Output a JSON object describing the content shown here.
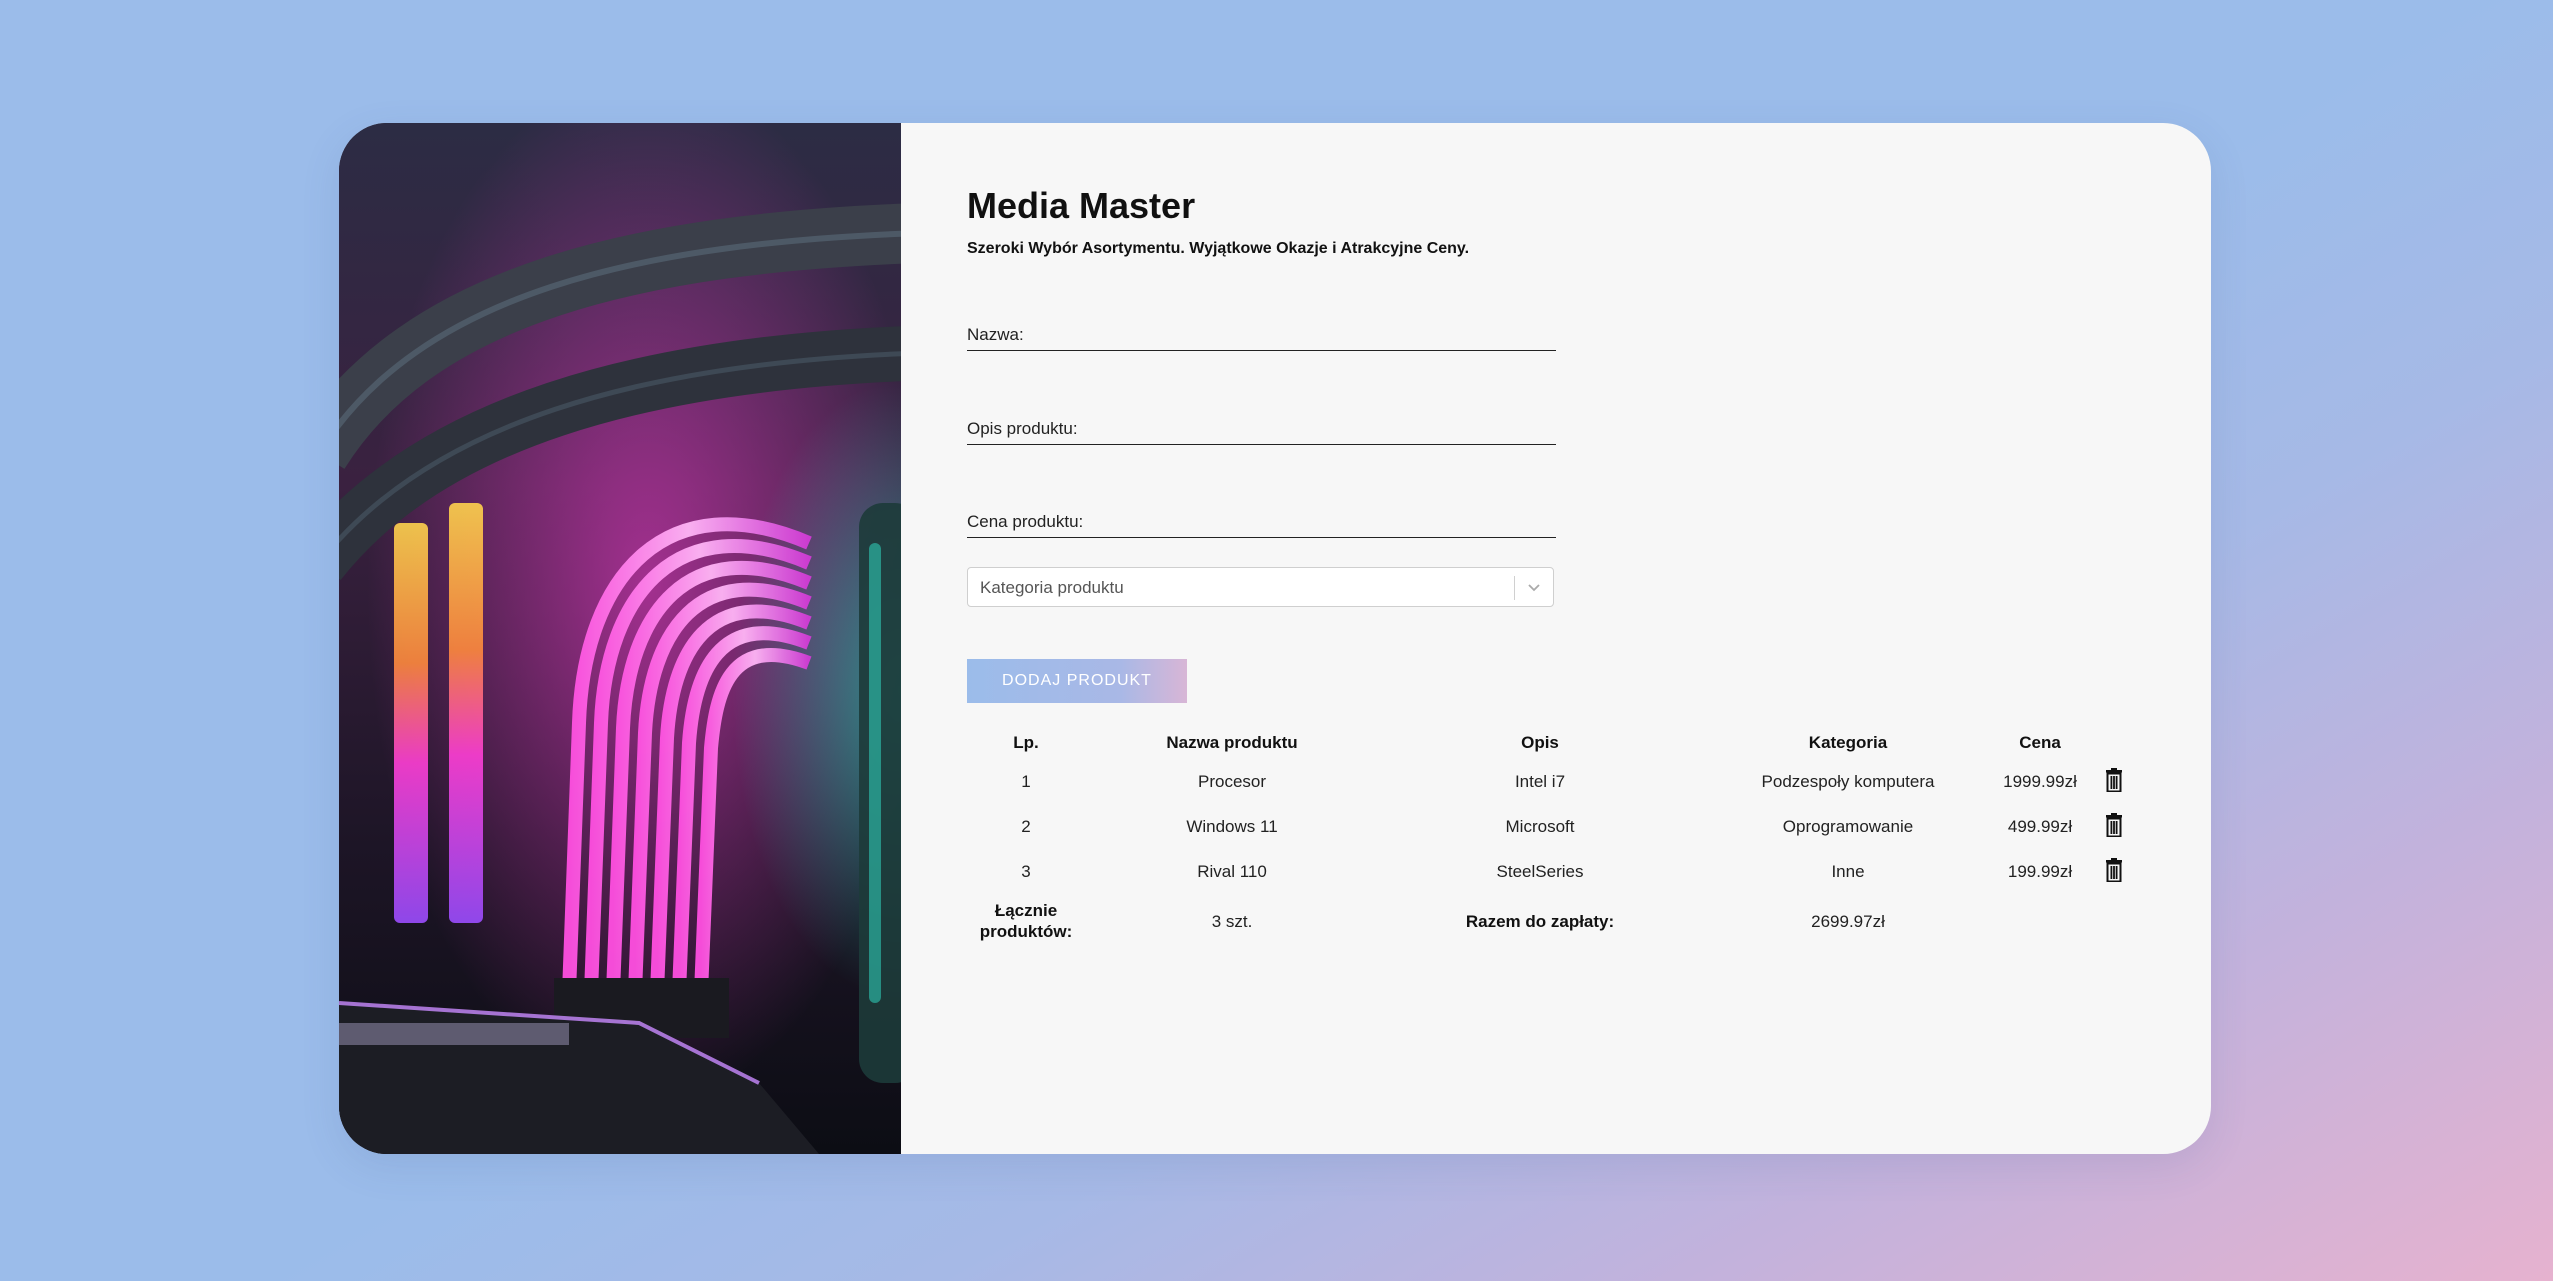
{
  "brand": {
    "title": "Media Master",
    "subtitle": "Szeroki Wybór Asortymentu. Wyjątkowe Okazje i Atrakcyjne Ceny."
  },
  "form": {
    "name_label": "Nazwa:",
    "description_label": "Opis produktu:",
    "price_label": "Cena produktu:",
    "category_placeholder": "Kategoria produktu",
    "add_button": "DODAJ PRODUKT"
  },
  "table": {
    "headers": [
      "Lp.",
      "Nazwa produktu",
      "Opis",
      "Kategoria",
      "Cena"
    ],
    "rows": [
      {
        "lp": "1",
        "name": "Procesor",
        "desc": "Intel i7",
        "category": "Podzespoły komputera",
        "price": "1999.99zł"
      },
      {
        "lp": "2",
        "name": "Windows 11",
        "desc": "Microsoft",
        "category": "Oprogramowanie",
        "price": "499.99zł"
      },
      {
        "lp": "3",
        "name": "Rival 110",
        "desc": "SteelSeries",
        "category": "Inne",
        "price": "199.99zł"
      }
    ],
    "summary": {
      "count_label_line1": "Łącznie",
      "count_label_line2": "produktów:",
      "count_value": "3 szt.",
      "total_label": "Razem do zapłaty:",
      "total_value": "2699.97zł"
    }
  },
  "colors": {
    "background": "#9bbcea",
    "card": "#f7f7f7",
    "button": "#9bbcea",
    "text": "#111111"
  },
  "icons": {
    "delete": "trash-icon",
    "dropdown": "chevron-down-icon"
  }
}
